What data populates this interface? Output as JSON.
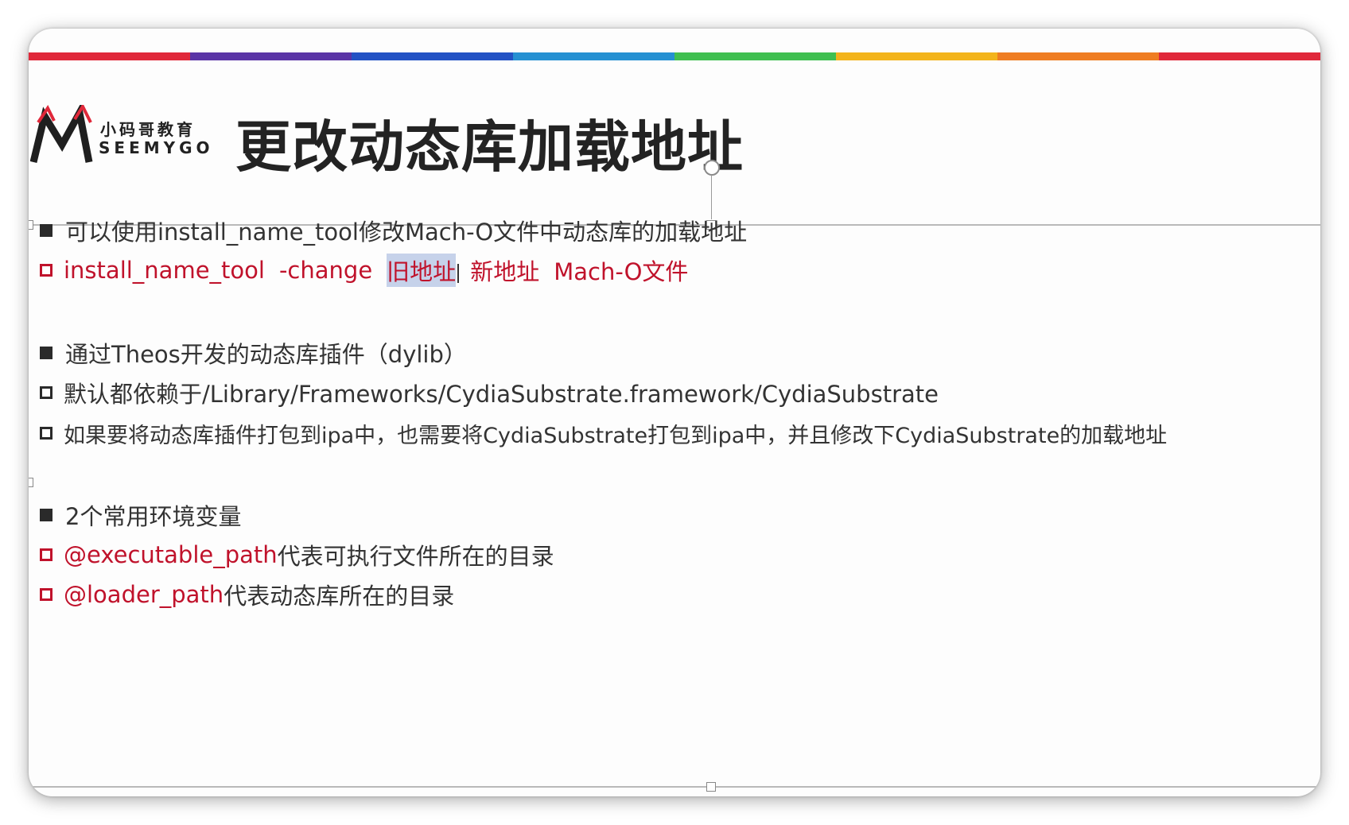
{
  "colors": {
    "rainbow": [
      "#e0283a",
      "#5a34a6",
      "#2352c4",
      "#2590d2",
      "#3fbf50",
      "#f3b41b",
      "#ef7d22",
      "#e0283a"
    ],
    "accent_red": "#c0122b",
    "text": "#333333"
  },
  "logo": {
    "mark": "M",
    "cn": "小码哥教育",
    "en": "SEEMYGO"
  },
  "slide": {
    "title": "更改动态库加载地址",
    "lines": [
      {
        "bullet": "filled",
        "text": "可以使用install_name_tool修改Mach-O文件中动态库的加载地址"
      },
      {
        "bullet": "hollow-red",
        "cmd": "install_name_tool",
        "flag": "-change",
        "old": "旧地址",
        "new": "新地址",
        "file": "Mach-O文件"
      },
      {
        "bullet": "filled",
        "text": "通过Theos开发的动态库插件（dylib）"
      },
      {
        "bullet": "hollow",
        "text": "默认都依赖于/Library/Frameworks/CydiaSubstrate.framework/CydiaSubstrate"
      },
      {
        "bullet": "hollow",
        "text": "如果要将动态库插件打包到ipa中，也需要将CydiaSubstrate打包到ipa中，并且修改下CydiaSubstrate的加载地址"
      },
      {
        "bullet": "filled",
        "text": "2个常用环境变量"
      },
      {
        "bullet": "hollow-red",
        "key": "@executable_path",
        "desc": "代表可执行文件所在的目录"
      },
      {
        "bullet": "hollow-red",
        "key": "@loader_path",
        "desc": "代表动态库所在的目录"
      }
    ]
  }
}
